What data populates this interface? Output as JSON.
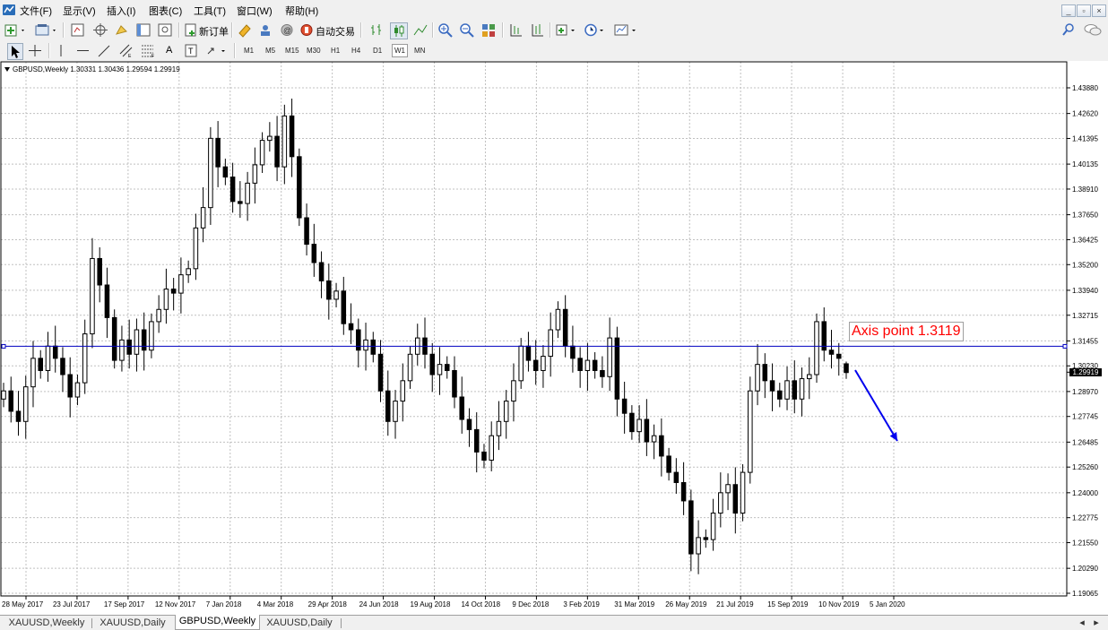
{
  "menu": [
    "文件(F)",
    "显示(V)",
    "插入(I)",
    "图表(C)",
    "工具(T)",
    "窗口(W)",
    "帮助(H)"
  ],
  "window_controls": {
    "minimize": "_",
    "restore": "▫",
    "close": "×"
  },
  "toolbar": {
    "new_order_label": "新订单",
    "auto_trade_label": "自动交易"
  },
  "periods": [
    "M1",
    "M5",
    "M15",
    "M30",
    "H1",
    "H4",
    "D1",
    "W1",
    "MN"
  ],
  "selected_period": "W1",
  "chart": {
    "header": "GBPUSD,Weekly  1.30331 1.30436 1.29594 1.29919",
    "current_price_label": "1.29919",
    "annotation": "Axis point 1.3119",
    "horizontal_line_price": 1.3119,
    "colors": {
      "grid": "#c0c0c0",
      "candle": "#000000",
      "hline": "#0000c0",
      "arrow": "#0000ee",
      "annotation": "#ff0000"
    }
  },
  "chart_data": {
    "type": "candlestick",
    "symbol": "GBPUSD",
    "timeframe": "Weekly",
    "ohlc_last": {
      "open": 1.30331,
      "high": 1.30436,
      "low": 1.29594,
      "close": 1.29919
    },
    "y_ticks": [
      "1.43880",
      "1.42620",
      "1.41395",
      "1.40135",
      "1.38910",
      "1.37650",
      "1.36425",
      "1.35200",
      "1.33940",
      "1.32715",
      "1.31455",
      "1.30230",
      "1.28970",
      "1.27745",
      "1.26485",
      "1.25260",
      "1.24000",
      "1.22775",
      "1.21550",
      "1.20290",
      "1.19065"
    ],
    "x_ticks": [
      "28 May 2017",
      "23 Jul 2017",
      "17 Sep 2017",
      "12 Nov 2017",
      "7 Jan 2018",
      "4 Mar 2018",
      "29 Apr 2018",
      "24 Jun 2018",
      "19 Aug 2018",
      "14 Oct 2018",
      "9 Dec 2018",
      "3 Feb 2019",
      "31 Mar 2019",
      "26 May 2019",
      "21 Jul 2019",
      "15 Sep 2019",
      "10 Nov 2019",
      "5 Jan 2020"
    ],
    "ylim": [
      1.19065,
      1.44
    ],
    "closes": [
      1.29,
      1.28,
      1.275,
      1.292,
      1.306,
      1.3,
      1.312,
      1.306,
      1.298,
      1.287,
      1.294,
      1.318,
      1.355,
      1.342,
      1.326,
      1.305,
      1.315,
      1.308,
      1.32,
      1.31,
      1.324,
      1.33,
      1.34,
      1.338,
      1.347,
      1.35,
      1.37,
      1.38,
      1.414,
      1.4,
      1.395,
      1.383,
      1.382,
      1.392,
      1.401,
      1.413,
      1.415,
      1.4,
      1.425,
      1.405,
      1.375,
      1.362,
      1.353,
      1.344,
      1.335,
      1.339,
      1.323,
      1.32,
      1.31,
      1.315,
      1.308,
      1.29,
      1.275,
      1.285,
      1.295,
      1.308,
      1.316,
      1.308,
      1.298,
      1.303,
      1.3,
      1.287,
      1.276,
      1.271,
      1.26,
      1.256,
      1.268,
      1.275,
      1.285,
      1.295,
      1.312,
      1.305,
      1.3,
      1.307,
      1.32,
      1.33,
      1.312,
      1.306,
      1.3,
      1.305,
      1.3,
      1.297,
      1.316,
      1.286,
      1.279,
      1.27,
      1.276,
      1.265,
      1.268,
      1.258,
      1.25,
      1.245,
      1.236,
      1.21,
      1.218,
      1.217,
      1.23,
      1.24,
      1.244,
      1.23,
      1.25,
      1.29,
      1.303,
      1.295,
      1.29,
      1.286,
      1.295,
      1.286,
      1.296,
      1.298,
      1.324,
      1.31,
      1.308,
      1.306,
      1.299
    ]
  },
  "tabs": [
    "XAUUSD,Weekly",
    "XAUUSD,Daily",
    "GBPUSD,Weekly",
    "XAUUSD,Daily"
  ],
  "active_tab": "GBPUSD,Weekly",
  "tab_scroll": {
    "left": "◂",
    "right": "▸"
  }
}
